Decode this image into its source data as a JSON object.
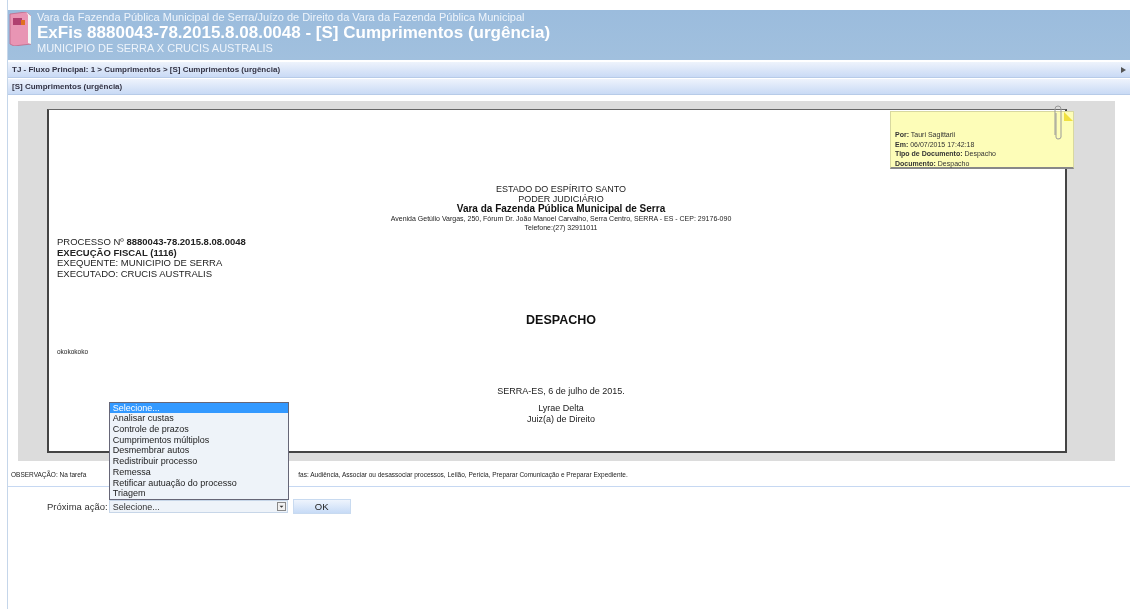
{
  "header": {
    "court": "Vara da Fazenda Pública Municipal de Serra/Juízo de Direito da Vara da Fazenda Pública Municipal",
    "title": "ExFis 8880043-78.2015.8.08.0048 - [S] Cumprimentos (urgência)",
    "parties": "MUNICIPIO DE SERRA X CRUCIS AUSTRALIS"
  },
  "breadcrumb": "TJ - Fluxo Principal: 1 > Cumprimentos > [S] Cumprimentos (urgência)",
  "task_title": "[S] Cumprimentos (urgência)",
  "note": {
    "lines": [
      "**Por:** Tauri Sagittarii",
      "**Em:** 06/07/2015 17:42:18",
      "**Tipo de Documento:** Despacho",
      "**Documento:** Despacho"
    ]
  },
  "document": {
    "letterhead": [
      {
        "text": "ESTADO DO ESPÍRITO SANTO",
        "kind": "normal"
      },
      {
        "text": "PODER JUDICIÁRIO",
        "kind": "normal"
      },
      {
        "text": "Vara da Fazenda Pública Municipal de Serra",
        "kind": "bold"
      },
      {
        "text": "Avenida Getúlio Vargas, 250, Fórum Dr. João Manoel Carvalho, Serra Centro, SERRA - ES - CEP: 29176-090",
        "kind": "small"
      },
      {
        "text": "Telefone:(27) 32911011",
        "kind": "small"
      }
    ],
    "process": [
      "PROCESSO Nº **8880043-78.2015.8.08.0048**",
      "**EXECUÇÃO FISCAL (1116)**",
      "EXEQUENTE: MUNICIPIO DE SERRA",
      "EXECUTADO: CRUCIS AUSTRALIS"
    ],
    "heading": "DESPACHO",
    "body": "okokokoko",
    "date": "SERRA-ES, 6 de julho de 2015.",
    "signer": "Lyrae Delta",
    "role": "Juiz(a) de Direito"
  },
  "observation": [
    "OBSERVAÇÃO: Na tarefa",
    "fas: Audiência, Associar ou desassociar processos, Leilão, Perícia, Preparar Comunicação e Preparar Expediente."
  ],
  "next_action": {
    "label": "Próxima ação:",
    "value": "Selecione...",
    "expanded": true,
    "options": [
      {
        "label": "Selecione...",
        "selected": true
      },
      {
        "label": "Analisar custas",
        "selected": false
      },
      {
        "label": "Controle de prazos",
        "selected": false
      },
      {
        "label": "Cumprimentos múltiplos",
        "selected": false
      },
      {
        "label": "Desmembrar autos",
        "selected": false
      },
      {
        "label": "Redistribuir processo",
        "selected": false
      },
      {
        "label": "Remessa",
        "selected": false
      },
      {
        "label": "Retificar autuação do processo",
        "selected": false
      },
      {
        "label": "Triagem",
        "selected": false
      }
    ],
    "button": "OK"
  }
}
